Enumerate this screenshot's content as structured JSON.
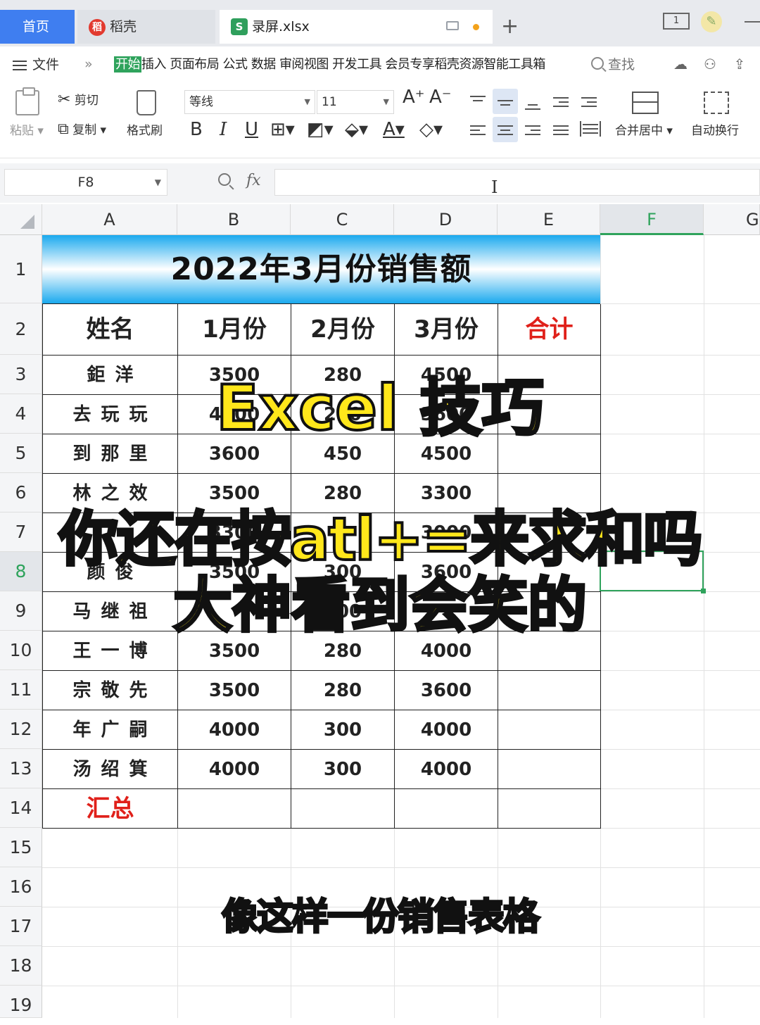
{
  "tabs": {
    "home": "首页",
    "daoke": "稻壳",
    "file": "录屏.xlsx",
    "new_tab": "+"
  },
  "menubar": {
    "file_menu": "文件",
    "more": "»",
    "items": [
      "开始",
      "插入",
      "页面布局",
      "公式",
      "数据",
      "审阅",
      "视图",
      "开发工具",
      "会员专享",
      "稻壳资源",
      "智能工具箱"
    ],
    "search": "查找"
  },
  "ribbon": {
    "paste": "粘贴",
    "cut": "剪切",
    "copy": "复制",
    "format_painter": "格式刷",
    "font_name": "等线",
    "font_size": "11",
    "bold": "B",
    "italic": "I",
    "underline": "U",
    "increase_font": "A⁺",
    "decrease_font": "A⁻",
    "merge_center": "合并居中",
    "auto_wrap": "自动换行"
  },
  "formula_bar": {
    "cell_ref": "F8",
    "fx": "fx",
    "value": ""
  },
  "columns": [
    "A",
    "B",
    "C",
    "D",
    "E",
    "F",
    "G"
  ],
  "rows": [
    "1",
    "2",
    "3",
    "4",
    "5",
    "6",
    "7",
    "8",
    "9",
    "10",
    "11",
    "12",
    "13",
    "14",
    "15",
    "16",
    "17",
    "18",
    "19"
  ],
  "sheet": {
    "title": "2022年3月份销售额",
    "headers": [
      "姓名",
      "1月份",
      "2月份",
      "3月份",
      "合计"
    ],
    "data": [
      [
        "鉅洋",
        "3500",
        "280",
        "4500"
      ],
      [
        "去玩玩",
        "4300",
        "280",
        "3600"
      ],
      [
        "到那里",
        "3600",
        "450",
        "4500"
      ],
      [
        "林之效",
        "3500",
        "280",
        "3300"
      ],
      [
        "",
        "3300",
        "",
        "3000"
      ],
      [
        "颜俊",
        "3500",
        "300",
        "3600"
      ],
      [
        "马继祖",
        "",
        "300",
        ""
      ],
      [
        "王一博",
        "3500",
        "280",
        "4000"
      ],
      [
        "宗敬先",
        "3500",
        "280",
        "3600"
      ],
      [
        "年广嗣",
        "4000",
        "300",
        "4000"
      ],
      [
        "汤绍箕",
        "4000",
        "300",
        "4000"
      ]
    ],
    "total_label": "汇总"
  },
  "overlay": {
    "line1": "Excel 技巧",
    "line2": "你还在按atl+=来求和吗",
    "line3": "大神看到会笑的",
    "subtitle": "像这样一份销售表格"
  },
  "colors": {
    "accent_green": "#2fa35c",
    "home_tab_blue": "#3f7ef0",
    "total_red": "#e0201a",
    "overlay_yellow": "#ffe71b"
  }
}
